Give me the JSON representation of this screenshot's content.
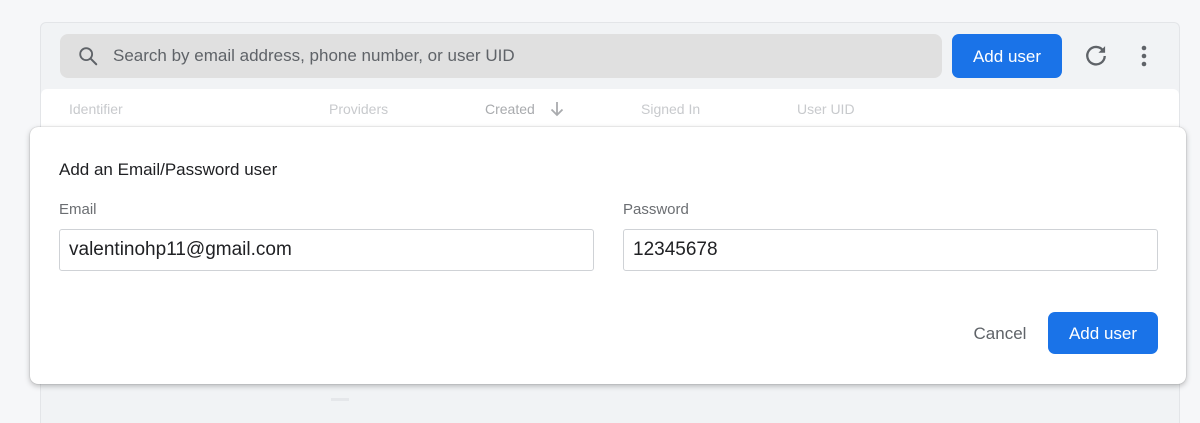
{
  "toolbar": {
    "search_placeholder": "Search by email address, phone number, or user UID",
    "add_user_label": "Add user",
    "search_icon": "search-icon",
    "refresh_icon": "refresh-icon",
    "more_icon": "more-vert-icon"
  },
  "table": {
    "columns": [
      "Identifier",
      "Providers",
      "Created",
      "Signed In",
      "User UID"
    ],
    "sort_icon": "arrow-down-icon"
  },
  "dialog": {
    "title": "Add an Email/Password user",
    "email_label": "Email",
    "email_value": "valentinohp11@gmail.com",
    "password_label": "Password",
    "password_value": "12345678",
    "cancel_label": "Cancel",
    "add_user_label": "Add user"
  },
  "colors": {
    "accent": "#1a73e8",
    "background": "#f6f7f9"
  }
}
